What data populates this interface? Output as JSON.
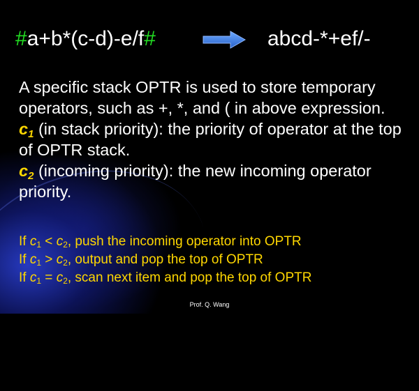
{
  "header": {
    "infix_hash_open": "#",
    "infix_expr": "a+b*(c-d)-e/f",
    "infix_hash_close": "#",
    "arrow_icon": "right-arrow-icon",
    "postfix_expr": "abcd-*+ef/-"
  },
  "body": {
    "para1": "A specific stack OPTR is used to store temporary operators, such as +, *, and ( in above expression.",
    "c1_letter": "c",
    "c1_sub": "1",
    "para2_rest": " (in stack priority): the priority of operator at the top of OPTR stack.",
    "c2_letter": "c",
    "c2_sub": "2",
    "para3_rest": " (incoming priority): the new incoming operator priority."
  },
  "rules": [
    {
      "prefix": "If ",
      "lhs": "c",
      "lhs_sub": "1",
      "op": " < ",
      "rhs": "c",
      "rhs_sub": "2",
      "action": ", push the incoming operator into OPTR"
    },
    {
      "prefix": "If ",
      "lhs": "c",
      "lhs_sub": "1",
      "op": " > ",
      "rhs": "c",
      "rhs_sub": "2",
      "action": ", output and pop the top of OPTR"
    },
    {
      "prefix": "If ",
      "lhs": "c",
      "lhs_sub": "1",
      "op": " = ",
      "rhs": "c",
      "rhs_sub": "2",
      "action": ", scan next item and pop the top of OPTR"
    }
  ],
  "footer": {
    "author": "Prof. Q. Wang"
  },
  "colors": {
    "background": "#000000",
    "hash": "#22dd22",
    "accent_yellow": "#ffd700",
    "arrow_blue": "#3a7fe0"
  }
}
